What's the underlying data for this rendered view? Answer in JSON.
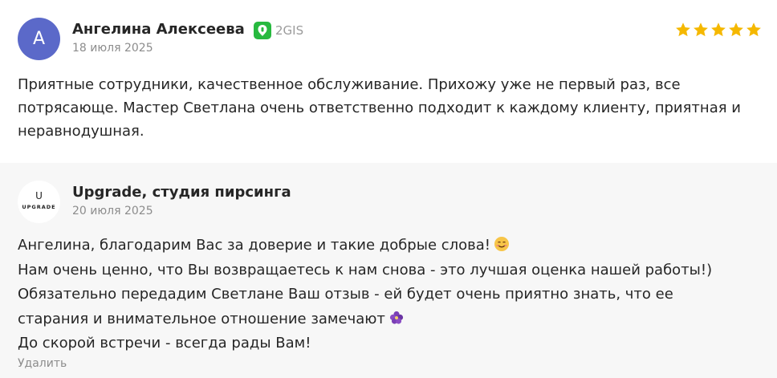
{
  "review": {
    "avatar_letter": "А",
    "avatar_color": "#5b69c9",
    "author_name": "Ангелина Алексеева",
    "source_label": "2GIS",
    "source_color": "#27b93f",
    "date": "18 июля 2025",
    "rating": 5,
    "rating_max": 5,
    "star_color": "#f5b800",
    "text": "Приятные сотрудники, качественное обслуживание. Прихожу уже не первый раз, все потрясающе. Мастер Светлана очень ответственно подходит к каждому клиенту, приятная и неравнодушная."
  },
  "reply": {
    "logo_mark": "U",
    "logo_text": "UPGRADE",
    "author_name": "Upgrade, студия пирсинга",
    "date": "20 июля 2025",
    "lines": [
      "Ангелина, благодарим Вас за доверие и такие добрые слова!",
      "Нам очень ценно, что Вы возвращаетесь к нам снова - это лучшая оценка нашей работы!)",
      "Обязательно передадим Светлане Ваш отзыв - ей будет очень приятно знать, что ее",
      "старания и внимательное отношение замечают",
      "До скорой встречи - всегда рады Вам!"
    ],
    "emoji_1": "smiling-face-icon",
    "emoji_2": "purple-flower-icon",
    "delete_label": "Удалить"
  }
}
